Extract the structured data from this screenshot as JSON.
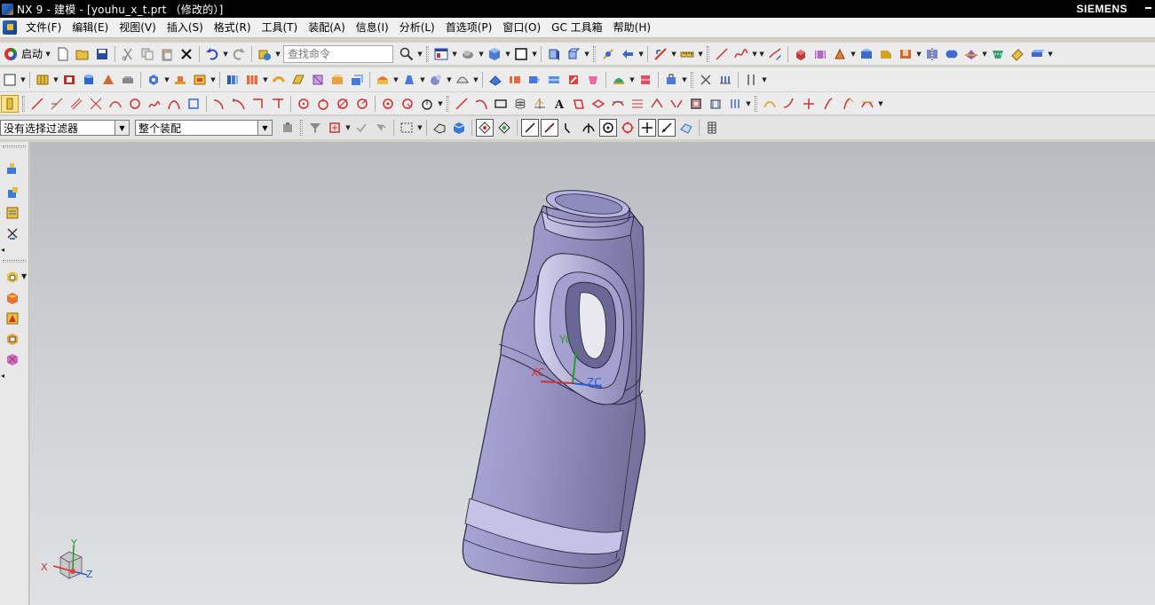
{
  "window": {
    "title": "NX 9 - 建模 - [youhu_x_t.prt （修改的）]",
    "brand": "SIEMENS"
  },
  "menu": [
    "文件(F)",
    "编辑(E)",
    "视图(V)",
    "插入(S)",
    "格式(R)",
    "工具(T)",
    "装配(A)",
    "信息(I)",
    "分析(L)",
    "首选项(P)",
    "窗口(O)",
    "GC 工具箱",
    "帮助(H)"
  ],
  "toolbar": {
    "start_label": "启动",
    "search_placeholder": "查找命令"
  },
  "selection": {
    "filter": "没有选择过滤器",
    "scope": "整个装配"
  },
  "viewport": {
    "wcs_labels": {
      "x": "XC",
      "y": "YC",
      "z": "ZC"
    },
    "triad_labels": {
      "x": "X",
      "y": "Y",
      "z": "Z"
    }
  },
  "colors": {
    "model_body": "#9b98c8",
    "model_shadow": "#6f6ca0",
    "model_highlight": "#cfcdea",
    "viewport_top": "#b8bcc0",
    "viewport_bottom": "#dfe1e3",
    "axis_x": "#d03030",
    "axis_y": "#2a9a2a",
    "axis_z": "#2a5ad0"
  }
}
